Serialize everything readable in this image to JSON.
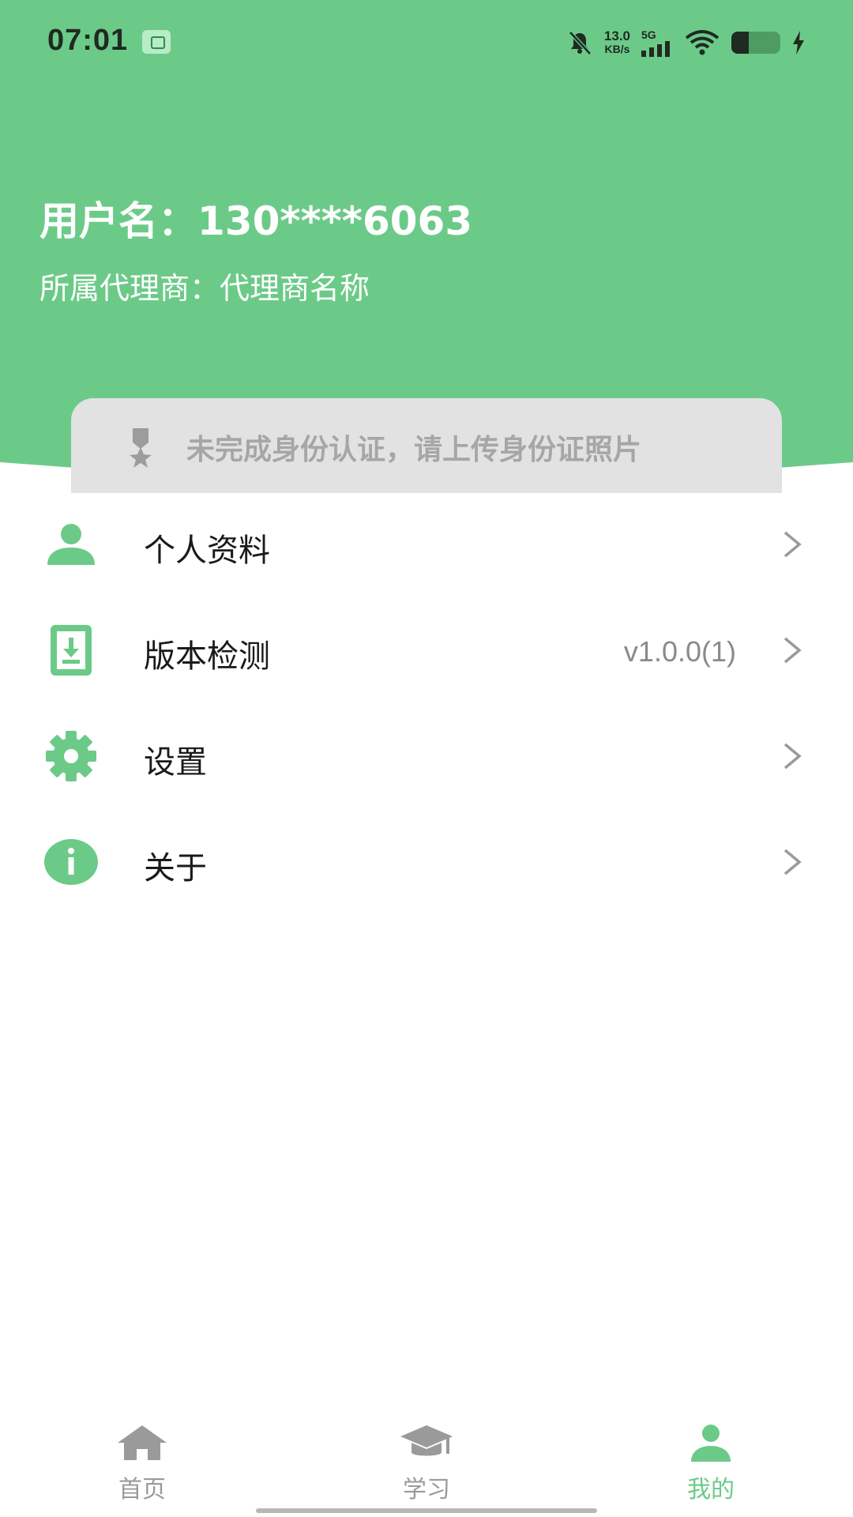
{
  "status_bar": {
    "time": "07:01",
    "net_speed_value": "13.0",
    "net_speed_unit": "KB/s",
    "signal_label": "5G"
  },
  "profile": {
    "username": "用户名：130****6063",
    "agent": "所属代理商：代理商名称"
  },
  "verification": {
    "text": "未完成身份认证，请上传身份证照片"
  },
  "menu": {
    "items": [
      {
        "label": "个人资料",
        "value": "",
        "icon": "person-icon"
      },
      {
        "label": "版本检测",
        "value": "v1.0.0(1)",
        "icon": "download-icon"
      },
      {
        "label": "设置",
        "value": "",
        "icon": "gear-icon"
      },
      {
        "label": "关于",
        "value": "",
        "icon": "info-icon"
      }
    ]
  },
  "bottom_nav": {
    "items": [
      {
        "label": "首页",
        "icon": "home-icon",
        "active": false
      },
      {
        "label": "学习",
        "icon": "graduation-cap-icon",
        "active": false
      },
      {
        "label": "我的",
        "icon": "person-icon",
        "active": true
      }
    ]
  },
  "colors": {
    "brand": "#6cca88",
    "card": "#e2e2e2",
    "muted": "#9a9a9a"
  }
}
